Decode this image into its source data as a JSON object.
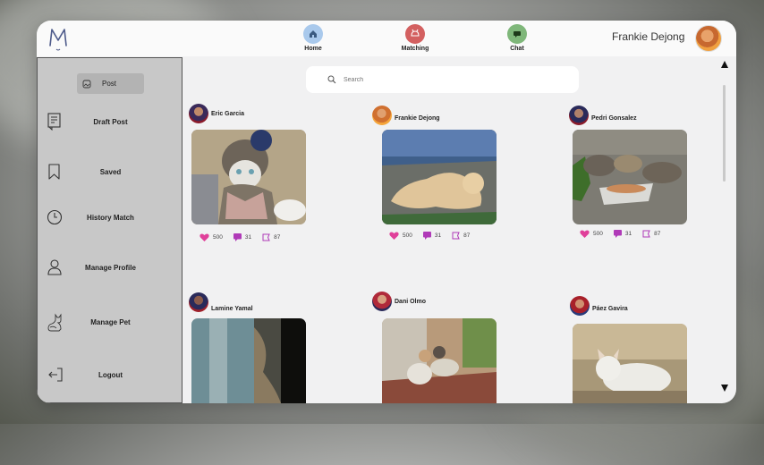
{
  "header": {
    "nav": [
      {
        "label": "Home",
        "icon": "home-icon",
        "color": "#a9c9ec"
      },
      {
        "label": "Matching",
        "icon": "matching-icon",
        "color": "#d36060"
      },
      {
        "label": "Chat",
        "icon": "chat-icon",
        "color": "#7fb77a"
      }
    ],
    "username": "Frankie Dejong"
  },
  "sidebar": {
    "post_label": "Post",
    "items": [
      {
        "label": "Draft Post",
        "icon": "draft-post-icon"
      },
      {
        "label": "Saved",
        "icon": "bookmark-icon"
      },
      {
        "label": "History Match",
        "icon": "clock-icon"
      },
      {
        "label": "Manage Profile",
        "icon": "user-icon"
      },
      {
        "label": "Manage Pet",
        "icon": "cat-icon"
      },
      {
        "label": "Logout",
        "icon": "logout-icon"
      }
    ]
  },
  "search": {
    "placeholder": "Search"
  },
  "posts": [
    {
      "author": "Eric Garcia",
      "likes": "500",
      "comments": "31",
      "saves": "87"
    },
    {
      "author": "Frankie Dejong",
      "likes": "500",
      "comments": "31",
      "saves": "87"
    },
    {
      "author": "Pedri Gonsalez",
      "likes": "500",
      "comments": "31",
      "saves": "87"
    },
    {
      "author": "Lamine Yamal"
    },
    {
      "author": "Dani Olmo"
    },
    {
      "author": "Páez Gavira"
    }
  ],
  "colors": {
    "like": "#e0409a",
    "comment": "#b03ab8",
    "save": "#b03ab8",
    "accent": "#f1f1f2"
  }
}
